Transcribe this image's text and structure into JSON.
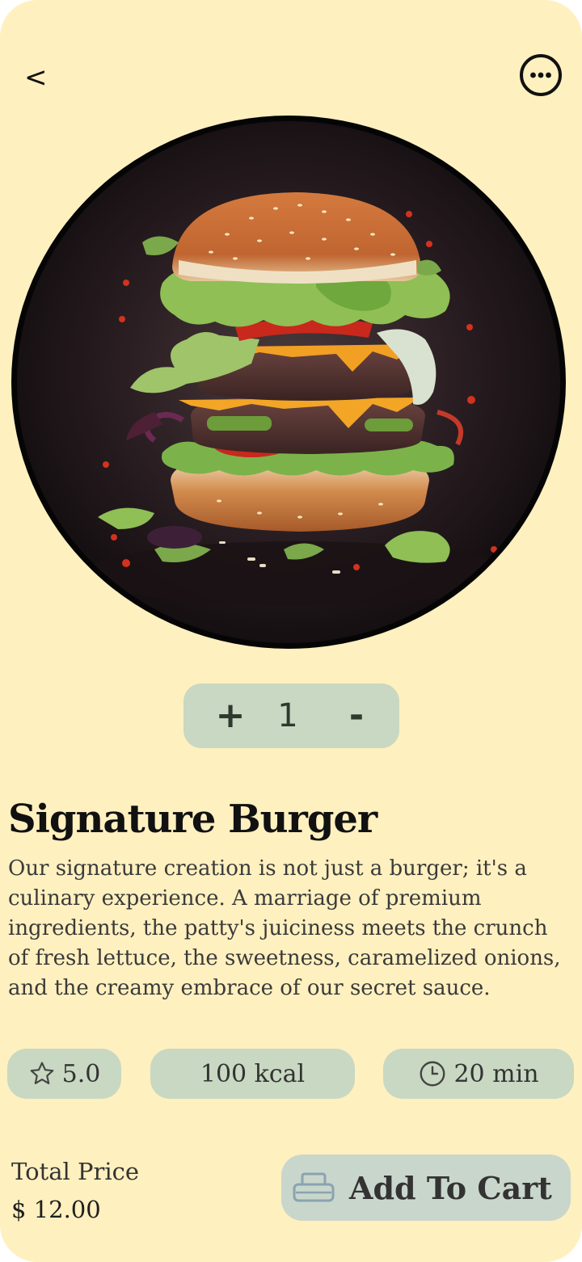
{
  "header": {
    "back_label": "<",
    "back_icon": "chevron-left-icon",
    "more_icon": "more-options-icon"
  },
  "hero": {
    "image": "burger-photo",
    "background_color": "#050505"
  },
  "quantity": {
    "plus_label": "+",
    "value": "1",
    "minus_label": "-"
  },
  "product": {
    "name": "Signature Burger",
    "description": "Our signature creation is not just a burger; it's a culinary experience. A marriage of premium ingredients, the patty's juiciness meets the crunch of fresh lettuce, the sweetness, caramelized onions, and the creamy embrace of our secret sauce."
  },
  "stats": {
    "rating": "5.0",
    "rating_icon": "star-icon",
    "calories": "100 kcal",
    "time": "20 min",
    "time_icon": "clock-icon"
  },
  "footer": {
    "total_label": "Total Price",
    "total_value": "$ 12.00",
    "cart_label": "Add To Cart",
    "cart_icon": "cart-icon"
  },
  "colors": {
    "background": "#fff0bf",
    "chip": "#c8d8c2",
    "button": "#c9d6cc",
    "text": "#111111"
  }
}
